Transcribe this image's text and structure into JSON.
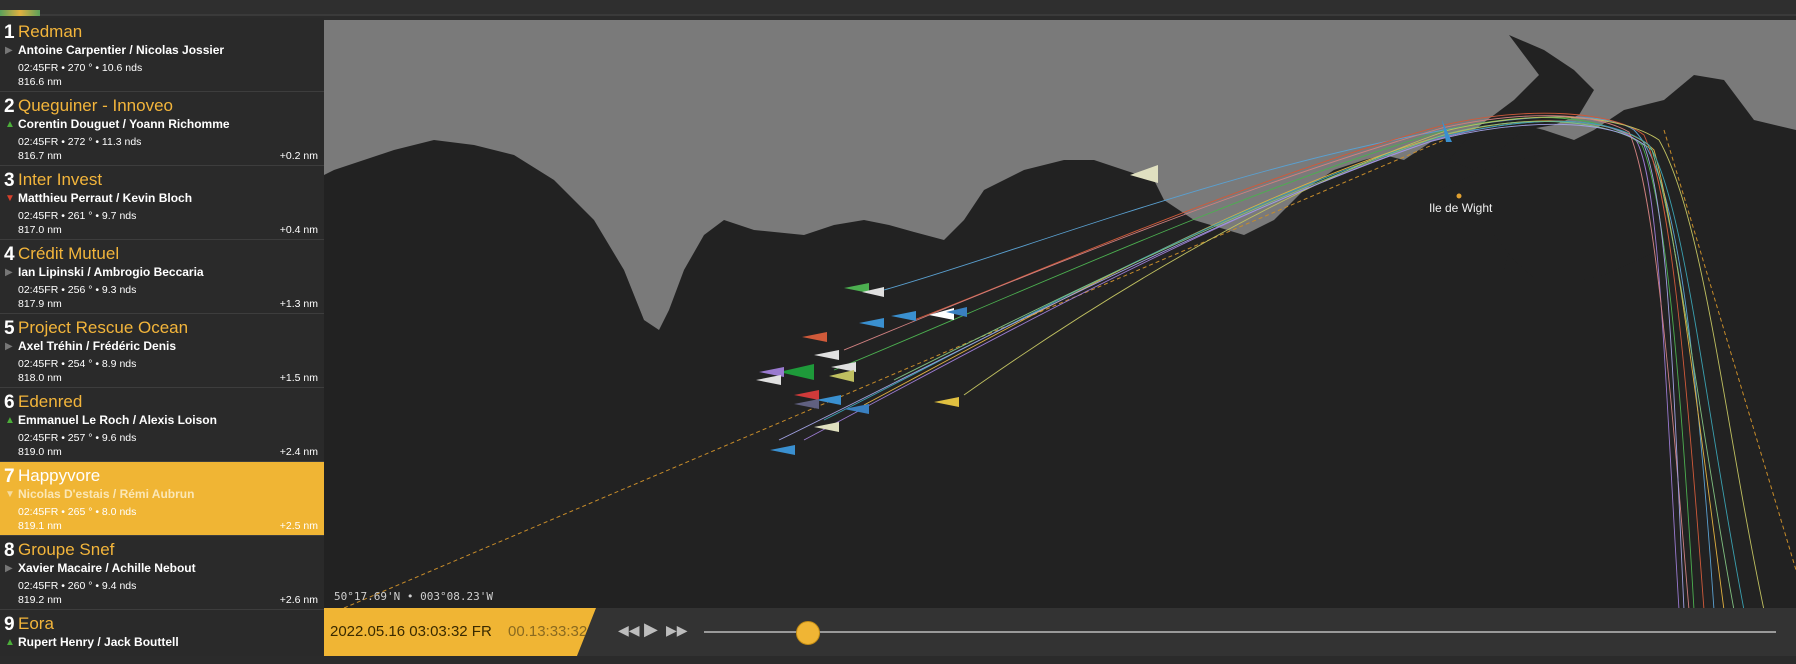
{
  "colors": {
    "accent": "#f0b534",
    "land": "#7a7a7a",
    "sea": "#222222"
  },
  "leaderboard": [
    {
      "rank": "1",
      "name": "Redman",
      "trend": "none",
      "skippers": "Antoine Carpentier / Nicolas Jossier",
      "meta": "02:45FR • 270 ° • 10.6 nds",
      "distance": "816.6 nm",
      "gap": ""
    },
    {
      "rank": "2",
      "name": "Queguiner - Innoveo",
      "trend": "up",
      "skippers": "Corentin Douguet / Yoann Richomme",
      "meta": "02:45FR • 272 ° • 11.3 nds",
      "distance": "816.7 nm",
      "gap": "+0.2 nm"
    },
    {
      "rank": "3",
      "name": "Inter Invest",
      "trend": "down",
      "skippers": "Matthieu Perraut / Kevin Bloch",
      "meta": "02:45FR • 261 ° • 9.7 nds",
      "distance": "817.0 nm",
      "gap": "+0.4 nm"
    },
    {
      "rank": "4",
      "name": "Crédit Mutuel",
      "trend": "none",
      "skippers": "Ian Lipinski / Ambrogio Beccaria",
      "meta": "02:45FR • 256 ° • 9.3 nds",
      "distance": "817.9 nm",
      "gap": "+1.3 nm"
    },
    {
      "rank": "5",
      "name": "Project Rescue Ocean",
      "trend": "none",
      "skippers": "Axel Tréhin / Frédéric Denis",
      "meta": "02:45FR • 254 ° • 8.9 nds",
      "distance": "818.0 nm",
      "gap": "+1.5 nm"
    },
    {
      "rank": "6",
      "name": "Edenred",
      "trend": "up",
      "skippers": "Emmanuel Le Roch / Alexis Loison",
      "meta": "02:45FR • 257 ° • 9.6 nds",
      "distance": "819.0 nm",
      "gap": "+2.4 nm"
    },
    {
      "rank": "7",
      "name": "Happyvore",
      "trend": "down",
      "skippers": "Nicolas D'estais / Rémi Aubrun",
      "meta": "02:45FR • 265 ° • 8.0 nds",
      "distance": "819.1 nm",
      "gap": "+2.5 nm",
      "selected": true
    },
    {
      "rank": "8",
      "name": "Groupe Snef",
      "trend": "none",
      "skippers": "Xavier Macaire / Achille Nebout",
      "meta": "02:45FR • 260 ° • 9.4 nds",
      "distance": "819.2 nm",
      "gap": "+2.6 nm"
    },
    {
      "rank": "9",
      "name": "Eora",
      "trend": "up",
      "skippers": "Rupert Henry / Jack Bouttell",
      "meta": "",
      "distance": "",
      "gap": ""
    }
  ],
  "map": {
    "place_label": "Ile de Wight",
    "coordinates": "50°17.69'N • 003°08.23'W"
  },
  "timeline": {
    "datetime": "2022.05.16 03:03:32 FR",
    "elapsed": "00.13:33:32",
    "progress": 0.1
  },
  "icons": {
    "rewind": "rewind-icon",
    "play": "play-icon",
    "forward": "forward-icon"
  }
}
